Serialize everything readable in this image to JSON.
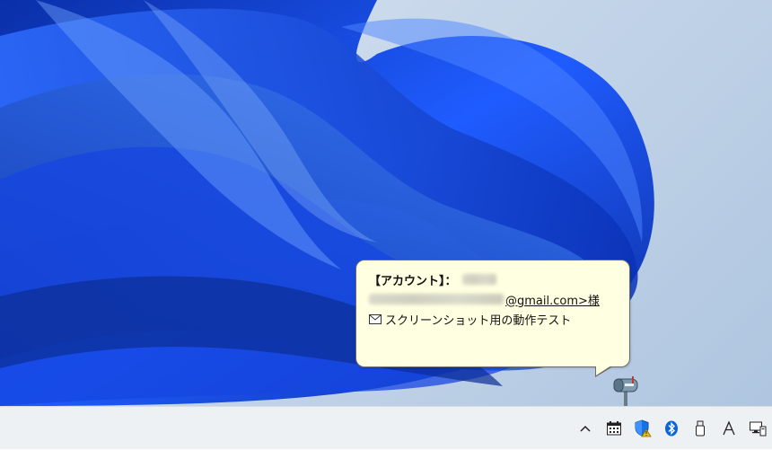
{
  "notification": {
    "account_label": "【アカウント】：",
    "account_name": "",
    "email_domain": "@gmail.com>様",
    "subject": "スクリーンショット用の動作テスト"
  },
  "tray": {
    "icons": [
      {
        "name": "show-hidden-icons-chevron",
        "glyph": "^"
      },
      {
        "name": "calendar-icon"
      },
      {
        "name": "security-shield-icon"
      },
      {
        "name": "bluetooth-icon"
      },
      {
        "name": "usb-device-icon"
      },
      {
        "name": "ime-indicator-icon",
        "glyph": "A"
      },
      {
        "name": "network-display-icon"
      }
    ]
  },
  "colors": {
    "balloon_background": "#ffffe1",
    "taskbar": "#eef1f4",
    "wallpaper_blue": "#0b3fd1"
  }
}
